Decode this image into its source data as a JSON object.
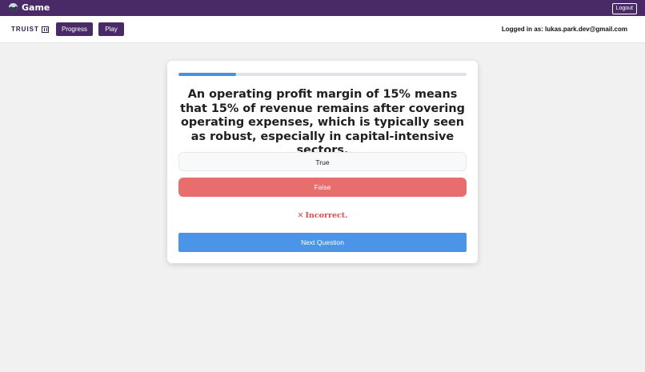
{
  "app": {
    "title": "Game",
    "logout_label": "Logout",
    "logo_icon": "globe-logo-icon"
  },
  "nav": {
    "brand": "TRUIST",
    "brand_icon": "truist-mark-icon",
    "progress_label": "Progress",
    "play_label": "Play",
    "logged_in_text": "Logged in as: lukas.park.dev@gmail.com"
  },
  "quiz": {
    "progress_fraction": 0.2,
    "question": "An operating profit margin of 15% means that 15% of revenue remains after covering operating expenses, which is typically seen as robust, especially in capital-intensive sectors.",
    "answers": [
      {
        "label": "True",
        "state": "neutral"
      },
      {
        "label": "False",
        "state": "selected-incorrect"
      }
    ],
    "feedback_icon": "✕",
    "feedback_text": "Incorrect.",
    "next_label": "Next Question"
  },
  "colors": {
    "header": "#4a2a66",
    "accent": "#4a95e8",
    "incorrect": "#e86e6e",
    "feedback": "#dc4c4c"
  }
}
